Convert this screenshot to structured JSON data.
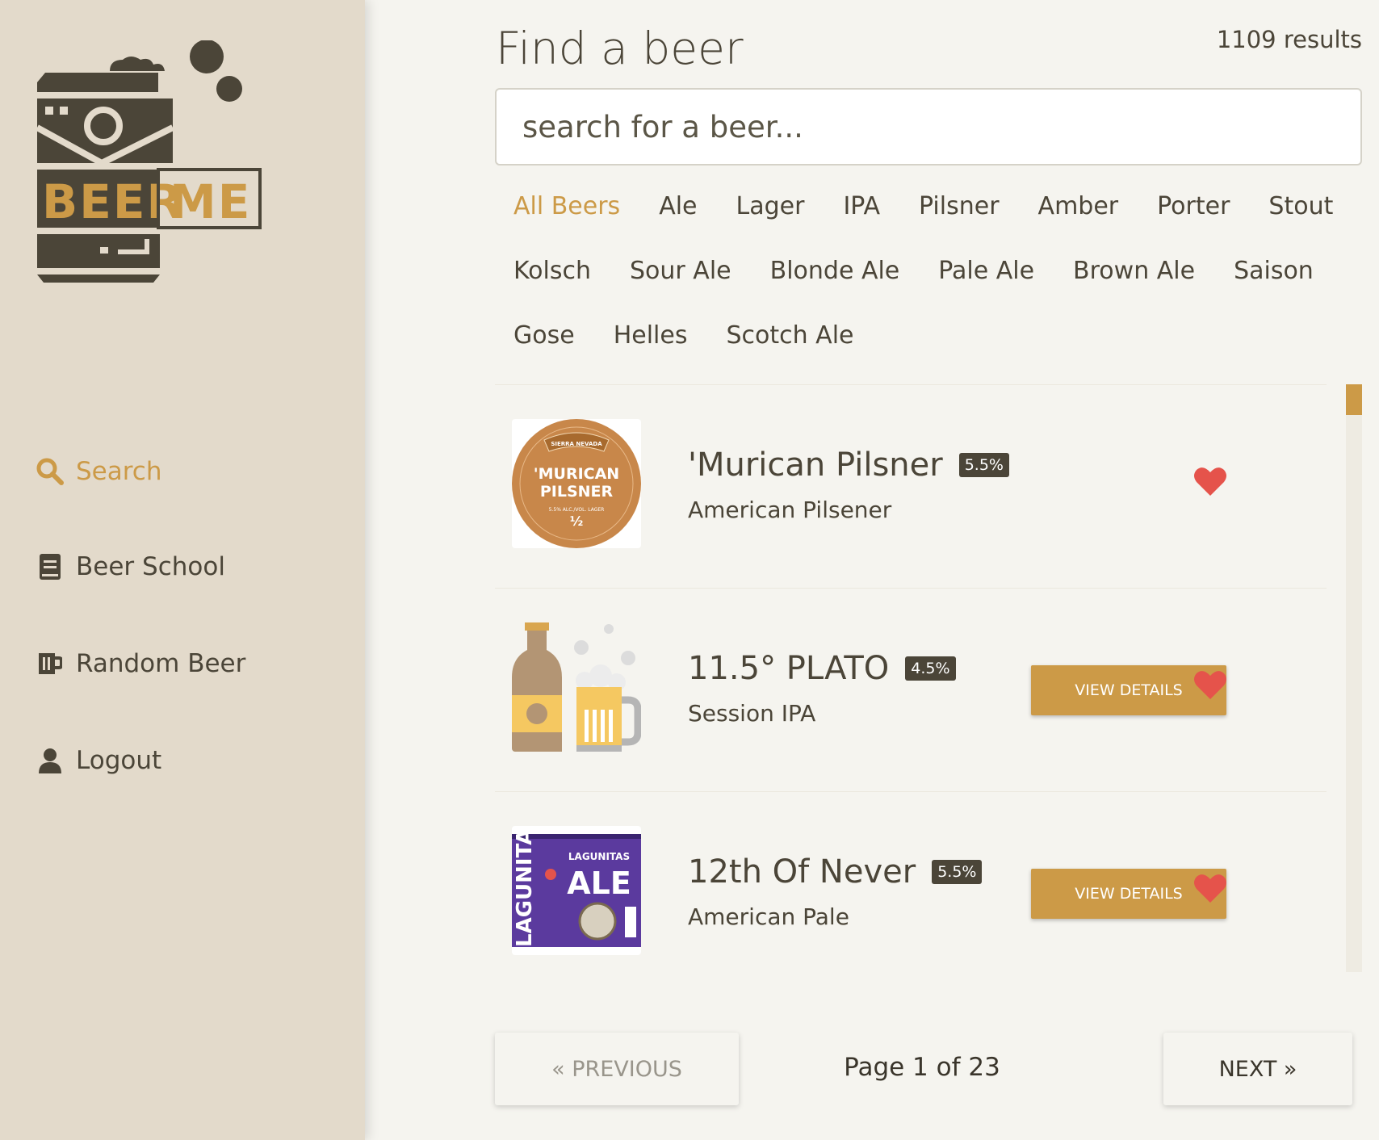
{
  "brand": {
    "logo_word1": "BEER",
    "logo_word2": "ME"
  },
  "sidebar": {
    "items": [
      {
        "label": "Search",
        "icon": "search-icon",
        "active": true
      },
      {
        "label": "Beer School",
        "icon": "book-icon",
        "active": false
      },
      {
        "label": "Random Beer",
        "icon": "beer-mug-icon",
        "active": false
      },
      {
        "label": "Logout",
        "icon": "user-icon",
        "active": false
      }
    ]
  },
  "main": {
    "title": "Find a beer",
    "results": "1109 results",
    "search": {
      "placeholder": "search for a beer...",
      "value": ""
    },
    "filters": [
      "All Beers",
      "Ale",
      "Lager",
      "IPA",
      "Pilsner",
      "Amber",
      "Porter",
      "Stout",
      "Kolsch",
      "Sour Ale",
      "Blonde Ale",
      "Pale Ale",
      "Brown Ale",
      "Saison",
      "Gose",
      "Helles",
      "Scotch Ale"
    ],
    "active_filter": "All Beers",
    "beers": [
      {
        "name": "'Murican Pilsner",
        "abv": "5.5%",
        "style": "American Pilsener",
        "button": "",
        "label_text": {
          "brand": "SIERRA NEVADA",
          "line1": "'MURICAN",
          "line2": "PILSNER",
          "small": "5.5% ALC./VOL. LAGER",
          "size": "½"
        }
      },
      {
        "name": "11.5° PLATO",
        "abv": "4.5%",
        "style": "Session IPA",
        "button": "VIEW DETAILS"
      },
      {
        "name": "12th Of Never",
        "abv": "5.5%",
        "style": "American Pale",
        "button": "VIEW DETAILS",
        "label_text": {
          "brand": "LAGUNITAS",
          "word": "ALE",
          "side": "LAGUNITAS"
        }
      }
    ],
    "scroll_position": 0
  },
  "pagination": {
    "prev": "« PREVIOUS",
    "next": "NEXT »",
    "page": "Page 1 of 23"
  },
  "colors": {
    "accent": "#cc9a47",
    "dark": "#4b4538",
    "sidebar": "#e3dacb",
    "background": "#f5f4ef",
    "heart": "#e5534b",
    "label_purple": "#5b3a9e"
  }
}
